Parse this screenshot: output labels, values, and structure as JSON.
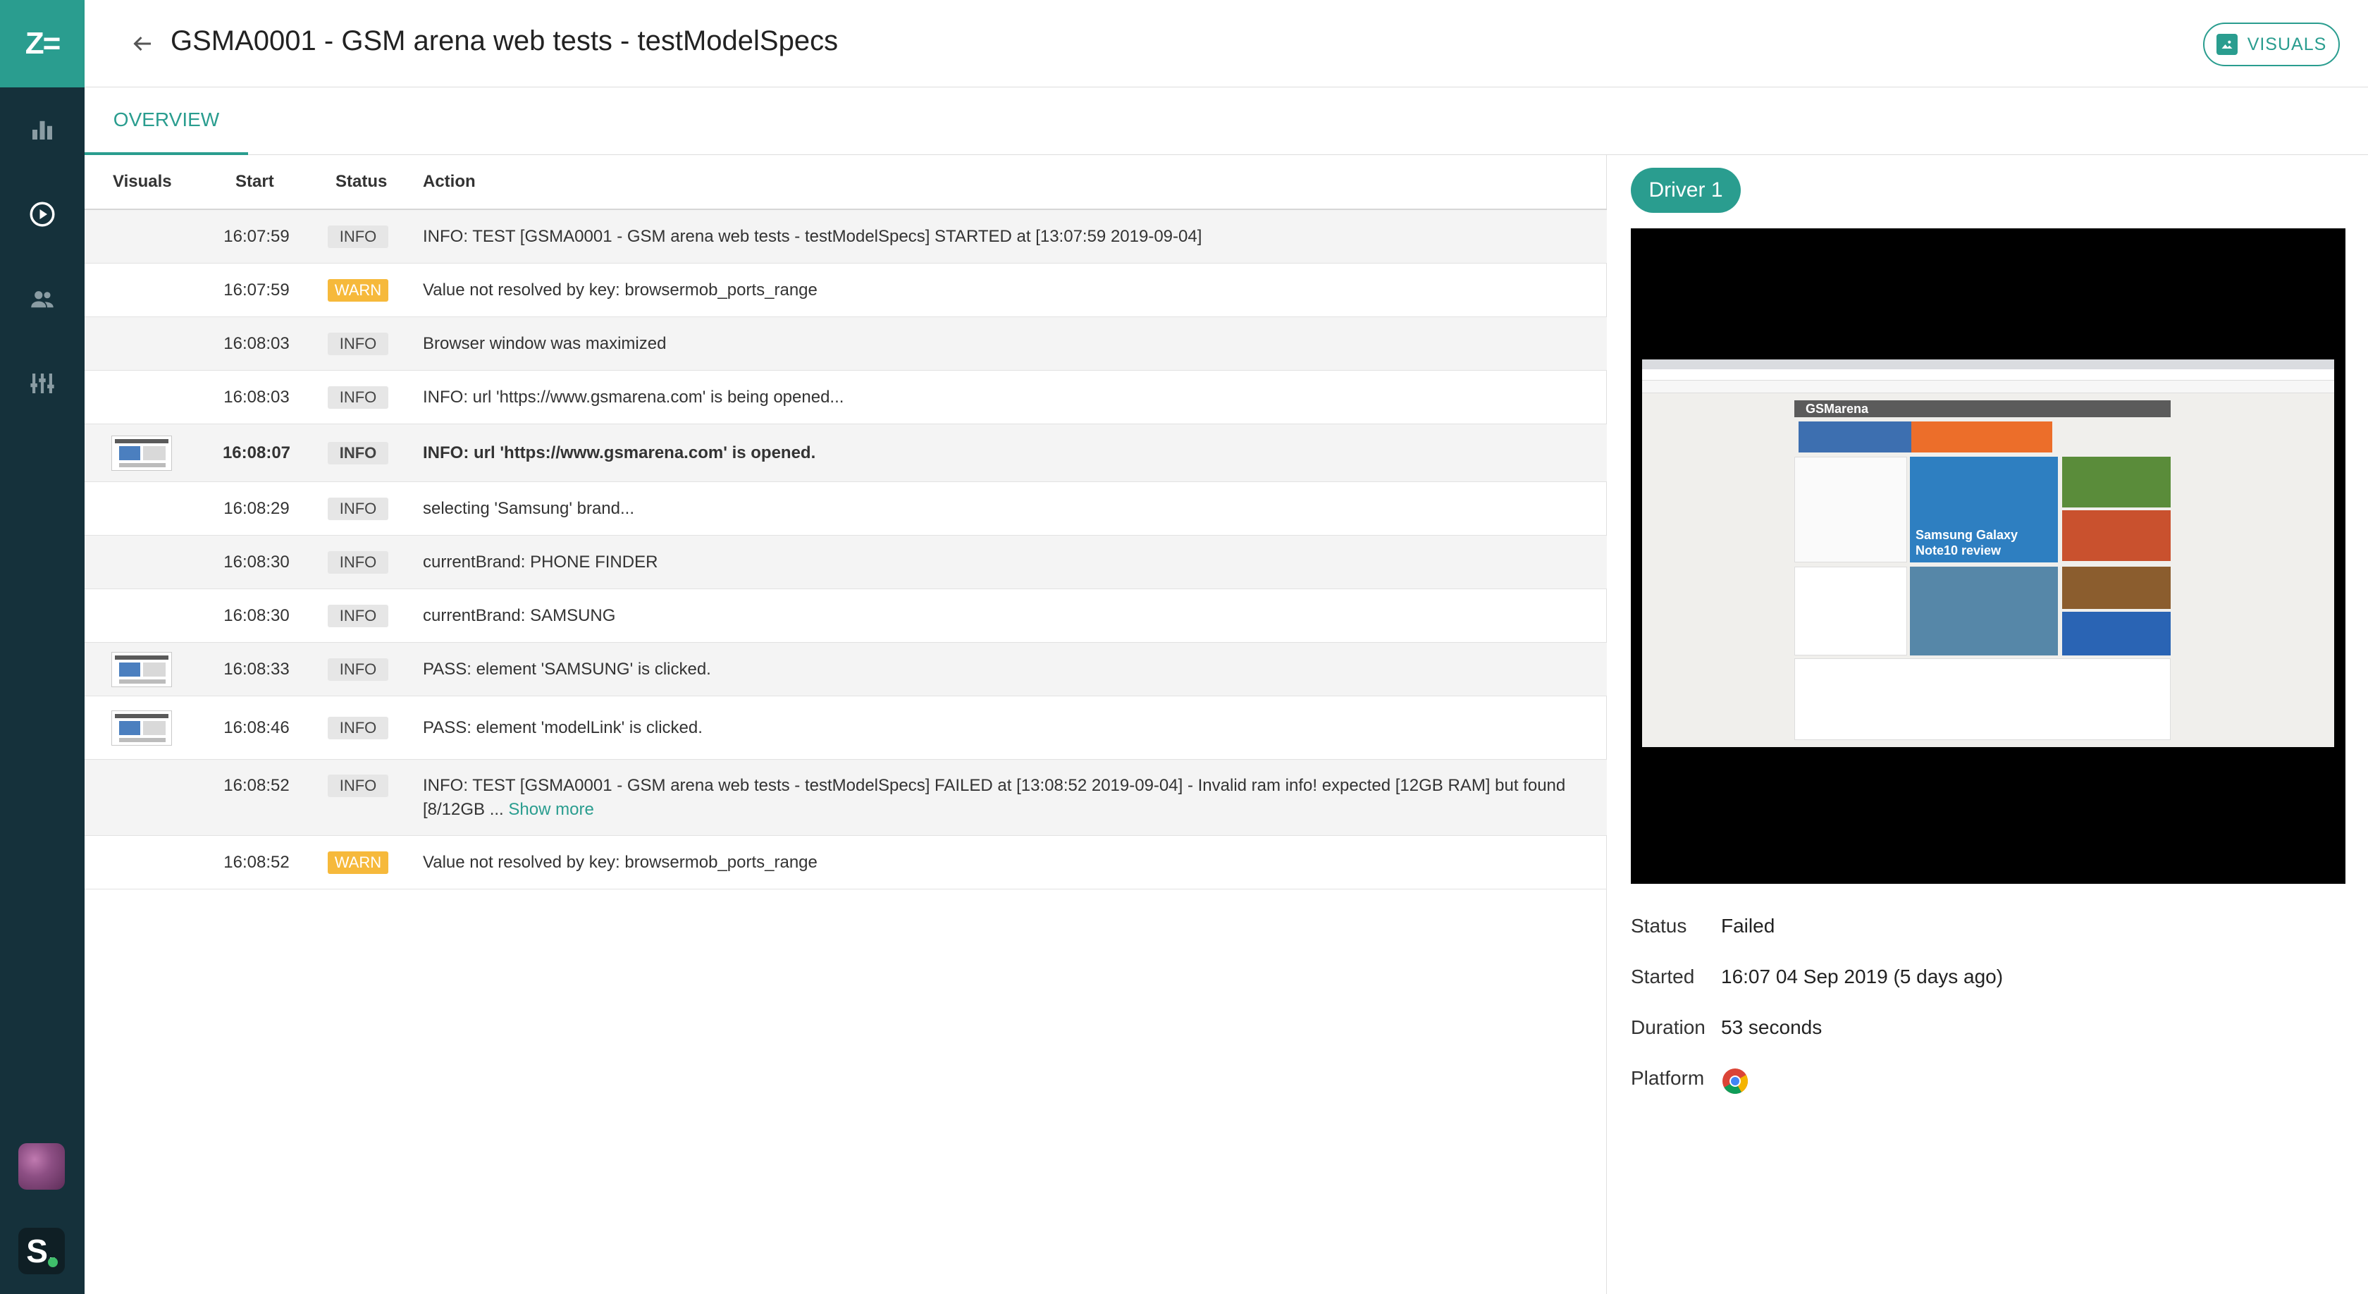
{
  "app": {
    "logo_text": "Z=",
    "accent_color": "#2a9d8f",
    "rail_color": "#15313b"
  },
  "nav": {
    "items": [
      {
        "name": "dashboard",
        "icon": "bar-chart-icon"
      },
      {
        "name": "test-runs",
        "icon": "play-circle-icon"
      },
      {
        "name": "members",
        "icon": "people-icon"
      },
      {
        "name": "integrations",
        "icon": "sliders-icon"
      }
    ],
    "app_badge": "S."
  },
  "header": {
    "title": "GSMA0001 - GSM arena web tests - testModelSpecs",
    "visuals_button": "VISUALS"
  },
  "tabs": [
    {
      "label": "OVERVIEW",
      "active": true
    }
  ],
  "log": {
    "columns": [
      "Visuals",
      "Start",
      "Status",
      "Action"
    ],
    "rows": [
      {
        "start": "16:07:59",
        "status": "INFO",
        "action": "INFO: TEST [GSMA0001 - GSM arena web tests - testModelSpecs] STARTED at [13:07:59 2019-09-04]",
        "thumb": false,
        "bold": false
      },
      {
        "start": "16:07:59",
        "status": "WARN",
        "action": "Value not resolved by key: browsermob_ports_range",
        "thumb": false,
        "bold": false
      },
      {
        "start": "16:08:03",
        "status": "INFO",
        "action": "Browser window was maximized",
        "thumb": false,
        "bold": false
      },
      {
        "start": "16:08:03",
        "status": "INFO",
        "action": "INFO: url 'https://www.gsmarena.com' is being opened...",
        "thumb": false,
        "bold": false
      },
      {
        "start": "16:08:07",
        "status": "INFO",
        "action": "INFO: url 'https://www.gsmarena.com' is opened.",
        "thumb": true,
        "bold": true
      },
      {
        "start": "16:08:29",
        "status": "INFO",
        "action": "selecting 'Samsung' brand...",
        "thumb": false,
        "bold": false
      },
      {
        "start": "16:08:30",
        "status": "INFO",
        "action": "currentBrand: PHONE FINDER",
        "thumb": false,
        "bold": false
      },
      {
        "start": "16:08:30",
        "status": "INFO",
        "action": "currentBrand: SAMSUNG",
        "thumb": false,
        "bold": false
      },
      {
        "start": "16:08:33",
        "status": "INFO",
        "action": "PASS: element 'SAMSUNG' is clicked.",
        "thumb": true,
        "bold": false
      },
      {
        "start": "16:08:46",
        "status": "INFO",
        "action": "PASS: element 'modelLink' is clicked.",
        "thumb": true,
        "bold": false
      },
      {
        "start": "16:08:52",
        "status": "INFO",
        "action": "INFO: TEST [GSMA0001 - GSM arena web tests - testModelSpecs] FAILED at [13:08:52 2019-09-04] - Invalid ram info! expected [12GB RAM] but found [8/12GB ...",
        "thumb": false,
        "bold": false,
        "show_more": "Show more"
      },
      {
        "start": "16:08:52",
        "status": "WARN",
        "action": "Value not resolved by key: browsermob_ports_range",
        "thumb": false,
        "bold": false
      }
    ]
  },
  "driver": {
    "label": "Driver 1",
    "preview": {
      "site_logo": "GSMarena",
      "hero_text": "Samsung Galaxy Note10 review"
    }
  },
  "details": {
    "status_label": "Status",
    "status_value": "Failed",
    "started_label": "Started",
    "started_value": "16:07 04 Sep 2019 (5 days ago)",
    "duration_label": "Duration",
    "duration_value": "53 seconds",
    "platform_label": "Platform",
    "platform_icon": "chrome-icon"
  }
}
